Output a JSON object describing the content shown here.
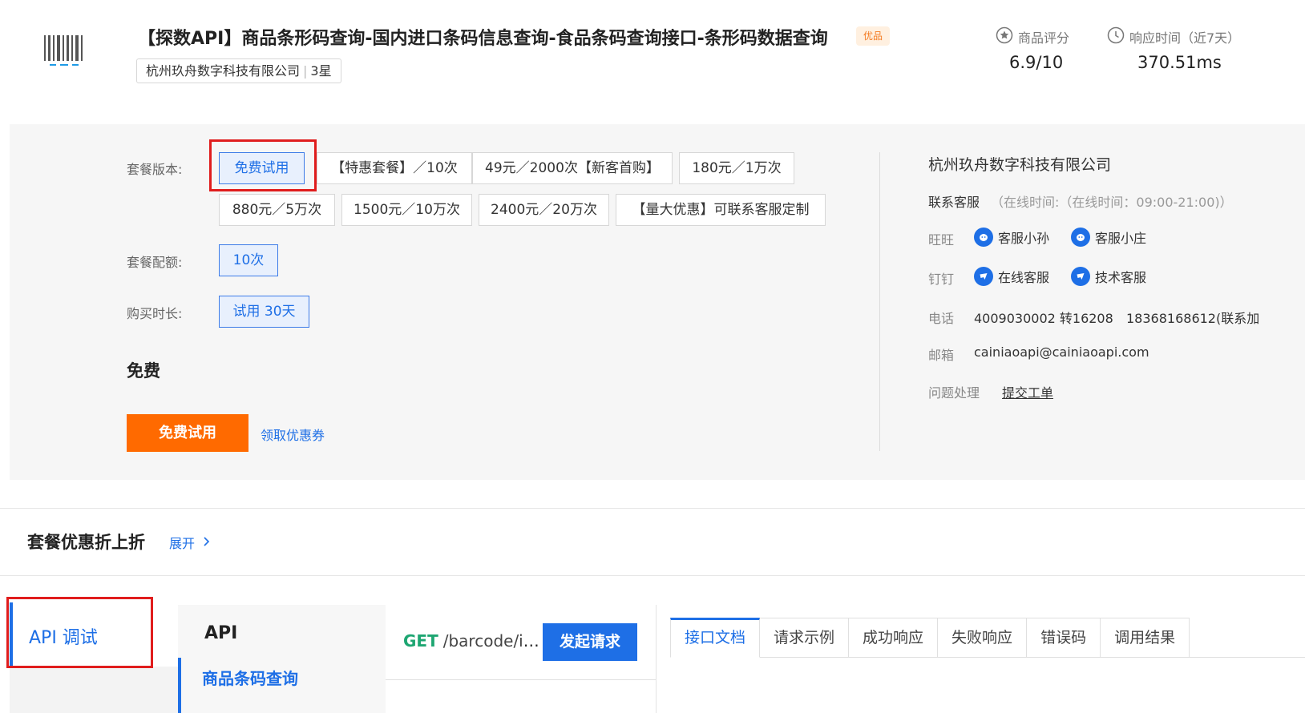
{
  "header": {
    "title": "【探数API】商品条形码查询-国内进口条码信息查询-食品条码查询接口-条形码数据查询",
    "quality_badge": "优品",
    "vendor": "杭州玖舟数字科技有限公司",
    "vendor_rating": "3星",
    "metrics": [
      {
        "label": "商品评分",
        "value": "6.9/10",
        "icon": "star-circle-icon"
      },
      {
        "label": "响应时间（近7天）",
        "value": "370.51ms",
        "icon": "clock-icon"
      }
    ]
  },
  "package": {
    "version_label": "套餐版本:",
    "versions": [
      "免费试用",
      "【特惠套餐】／10次",
      "49元／2000次【新客首购】",
      "180元／1万次",
      "880元／5万次",
      "1500元／10万次",
      "2400元／20万次",
      "【量大优惠】可联系客服定制"
    ],
    "selected_version": "免费试用",
    "quota_label": "套餐配额:",
    "quota": "10次",
    "duration_label": "购买时长:",
    "duration": "试用 30天",
    "price": "免费",
    "try_button": "免费试用",
    "coupon_link": "领取优惠券"
  },
  "vendor_info": {
    "company": "杭州玖舟数字科技有限公司",
    "support_label": "联系客服",
    "support_hours": "（在线时间:（在线时间：09:00-21:00)）",
    "wangwang_label": "旺旺",
    "wangwang_contacts": [
      "客服小孙",
      "客服小庄"
    ],
    "dingding_label": "钉钉",
    "dingding_contacts": [
      "在线客服",
      "技术客服"
    ],
    "phone_label": "电话",
    "phone_1": "4009030002 转16208",
    "phone_2": "18368168612(联系加",
    "email_label": "邮箱",
    "email": "cainiaoapi@cainiaoapi.com",
    "issue_label": "问题处理",
    "issue_link": "提交工单"
  },
  "discount": {
    "title": "套餐优惠折上折",
    "expand": "展开"
  },
  "debug": {
    "side_tab": "API 调试",
    "api_heading": "API",
    "api_item": "商品条码查询",
    "method": "GET",
    "path": "/barcode/in…",
    "send_button": "发起请求",
    "tabs": [
      "接口文档",
      "请求示例",
      "成功响应",
      "失败响应",
      "错误码",
      "调用结果"
    ],
    "active_tab": "接口文档"
  },
  "colors": {
    "accent": "#1e6fe6",
    "orange": "#ff6a00",
    "highlight_box": "#e01d1d",
    "method_get": "#1ea672"
  }
}
